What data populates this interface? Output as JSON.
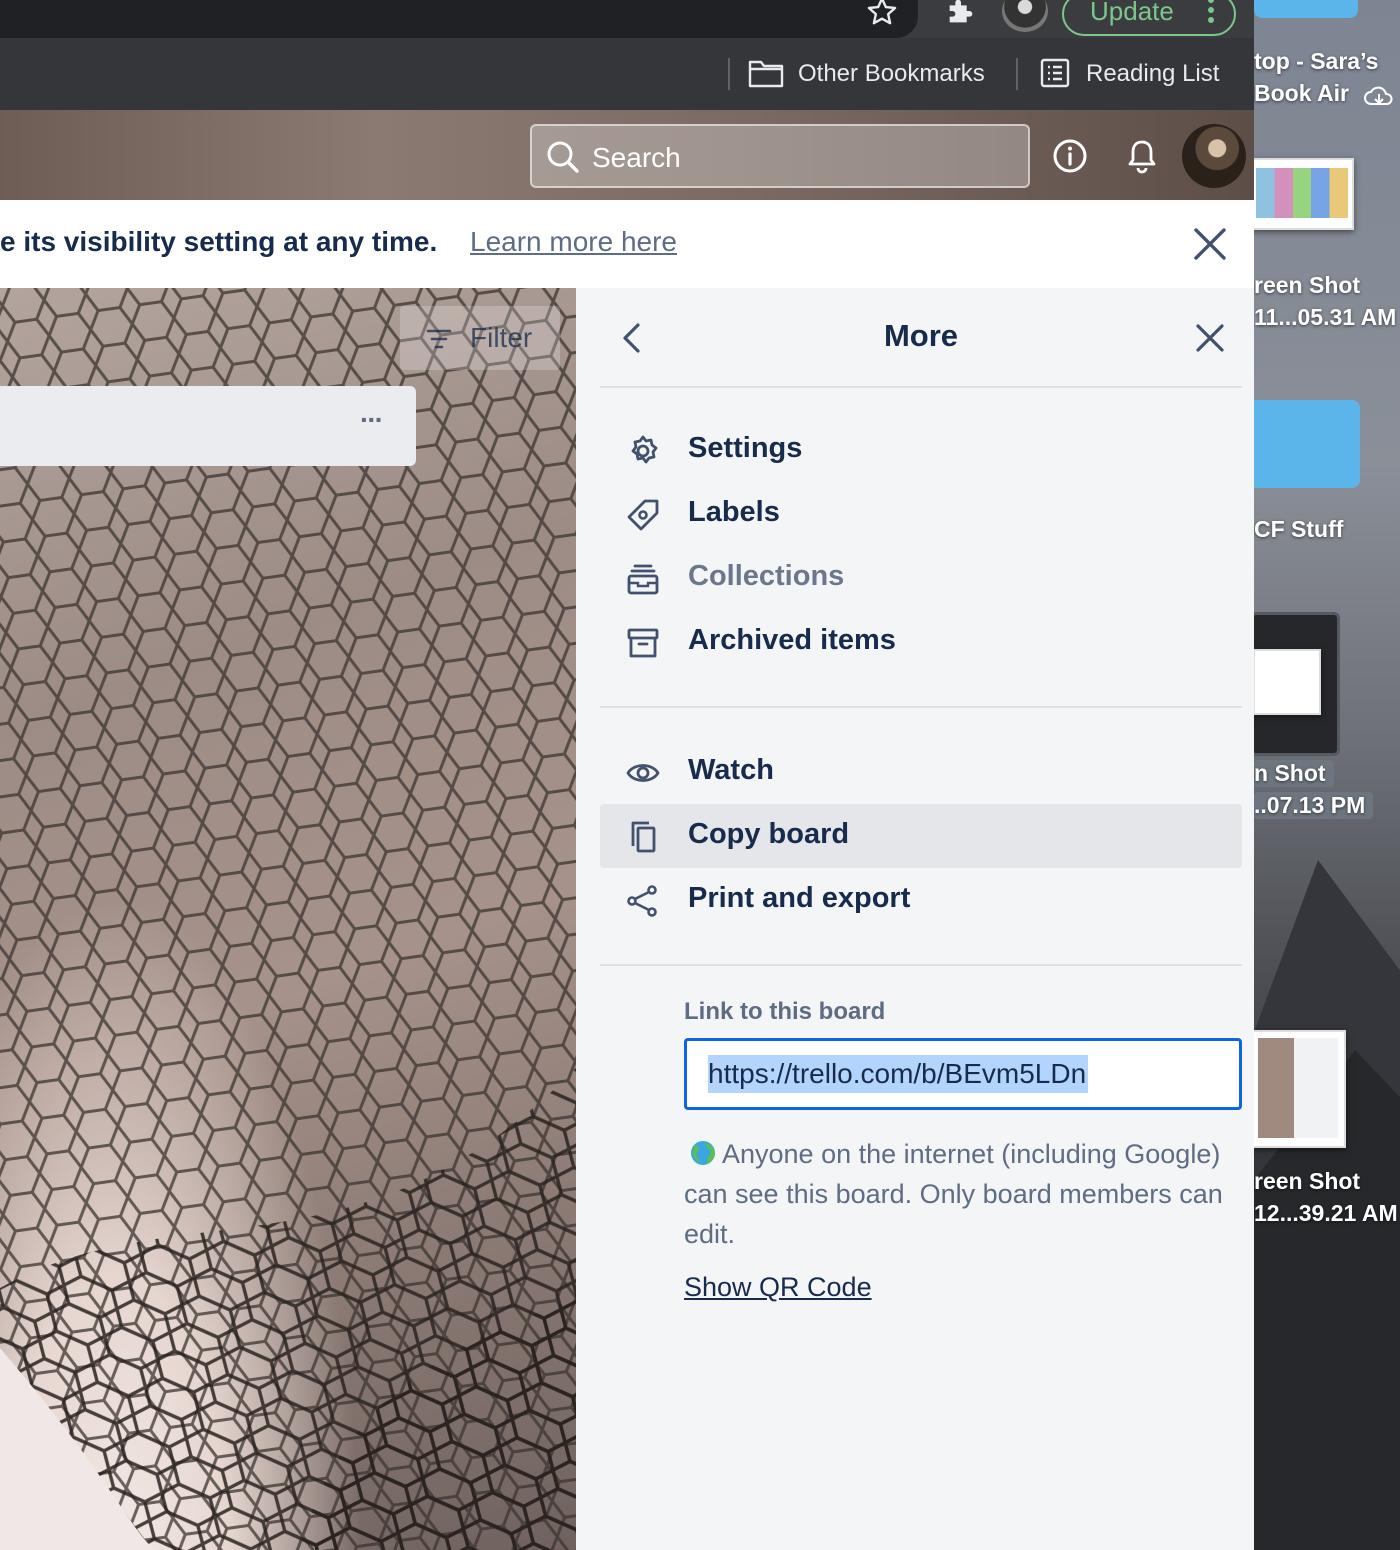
{
  "browser": {
    "update_label": "Update",
    "bookmarks": [
      {
        "label": "Other Bookmarks",
        "icon": "folder-icon"
      },
      {
        "label": "Reading List",
        "icon": "reading-list-icon"
      }
    ]
  },
  "header": {
    "search_placeholder": "Search"
  },
  "banner": {
    "text": "e its visibility setting at any time.",
    "link": "Learn more here"
  },
  "board": {
    "filter_label": "Filter",
    "list_menu": "···"
  },
  "panel": {
    "title": "More",
    "section1": [
      {
        "label": "Settings",
        "icon": "gear-icon"
      },
      {
        "label": "Labels",
        "icon": "tag-icon"
      },
      {
        "label": "Collections",
        "icon": "collections-icon"
      },
      {
        "label": "Archived items",
        "icon": "archive-icon"
      }
    ],
    "section2": [
      {
        "label": "Watch",
        "icon": "eye-icon"
      },
      {
        "label": "Copy board",
        "icon": "copy-icon"
      },
      {
        "label": "Print and export",
        "icon": "share-icon"
      }
    ],
    "link_label": "Link to this board",
    "link_value": "https://trello.com/b/BEvm5LDn",
    "visibility_text": "Anyone on the internet (including Google) can see this board. Only board members can edit.",
    "qr_label": "Show QR Code"
  },
  "desktop": {
    "items": [
      {
        "line1": "top - Sara’s",
        "line2": "Book Air"
      },
      {
        "line1": "reen Shot",
        "line2": "11...05.31 AM"
      },
      {
        "line1": "CF Stuff",
        "line2": ""
      },
      {
        "line1": "n Shot",
        "line2": "..07.13 PM"
      },
      {
        "line1": "reen Shot",
        "line2": "12...39.21 AM"
      }
    ]
  },
  "colors": {
    "accent": "#0c66e4",
    "text_primary": "#172b4d",
    "text_muted": "#5e6c84",
    "update_green": "#7cc78a",
    "panel_bg": "#f4f5f7"
  }
}
